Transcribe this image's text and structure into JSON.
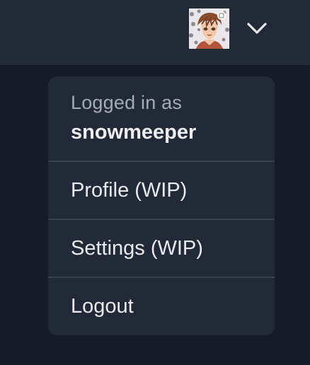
{
  "header": {
    "avatar_icon": "user-avatar-image",
    "menu_toggle_icon": "chevron-down-icon"
  },
  "menu": {
    "logged_in_label": "Logged in as",
    "username": "snowmeeper",
    "items": [
      {
        "label": "Profile (WIP)"
      },
      {
        "label": "Settings (WIP)"
      },
      {
        "label": "Logout"
      }
    ]
  },
  "colors": {
    "page_background": "#151b29",
    "surface": "#222a38",
    "divider": "#3a4252",
    "text_primary": "#e9ebef",
    "text_muted": "#a4abb8"
  }
}
